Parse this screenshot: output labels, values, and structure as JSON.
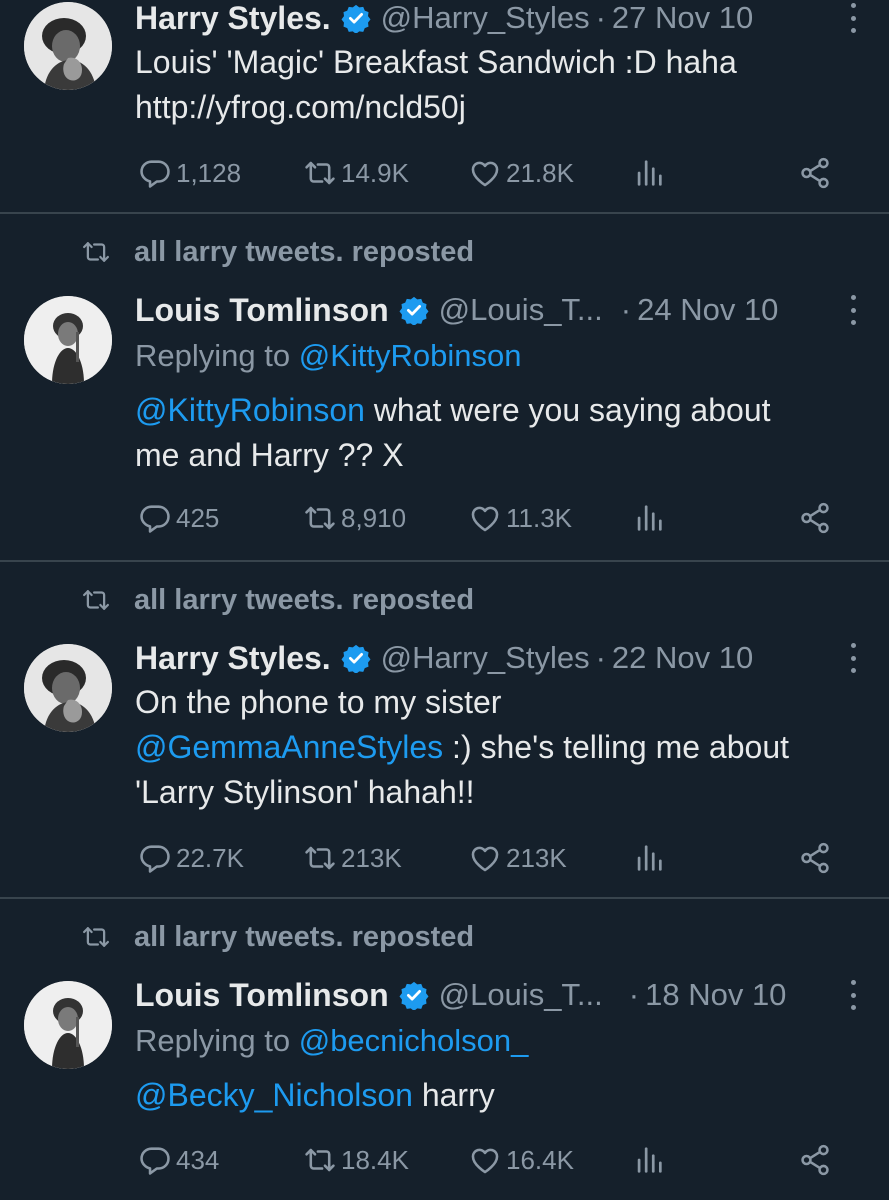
{
  "repost_label": "all larry tweets. reposted",
  "tweets": [
    {
      "name": "Harry Styles.",
      "handle": "@Harry_Styles",
      "date": "27 Nov 10",
      "replying_prefix": "",
      "replying_to": "",
      "mention": "",
      "text_line1": "Louis' 'Magic' Breakfast Sandwich :D haha",
      "text_line2": "http://yfrog.com/ncld50j",
      "text_line3": "",
      "replies": "1,128",
      "reposts": "14.9K",
      "likes": "21.8K"
    },
    {
      "name": "Louis Tomlinson",
      "handle": "@Louis_T...",
      "date": "24 Nov 10",
      "replying_prefix": "Replying to ",
      "replying_to": "@KittyRobinson",
      "mention": "@KittyRobinson",
      "text_line1": " what were you saying about",
      "text_line2": "me and Harry ?? X",
      "text_line3": "",
      "replies": "425",
      "reposts": "8,910",
      "likes": "11.3K"
    },
    {
      "name": "Harry Styles.",
      "handle": "@Harry_Styles",
      "date": "22 Nov 10",
      "replying_prefix": "",
      "replying_to": "",
      "mention": "@GemmaAnneStyles",
      "text_line1": "On the phone to my sister",
      "text_line2": " :) she's telling me about",
      "text_line3": "'Larry Stylinson' hahah!!",
      "replies": "22.7K",
      "reposts": "213K",
      "likes": "213K"
    },
    {
      "name": "Louis Tomlinson",
      "handle": "@Louis_T...",
      "date": "18 Nov 10",
      "replying_prefix": "Replying to ",
      "replying_to": "@becnicholson_",
      "mention": "@Becky_Nicholson",
      "text_line1": " harry",
      "text_line2": "",
      "text_line3": "",
      "replies": "434",
      "reposts": "18.4K",
      "likes": "16.4K"
    }
  ],
  "colors": {
    "background": "#15202b",
    "text": "#e7e9ea",
    "muted": "#8b98a5",
    "accent": "#1d9bf0",
    "divider": "#38444d"
  },
  "icons": [
    "repost-icon",
    "verified-badge-icon",
    "more-icon",
    "reply-icon",
    "like-icon",
    "views-icon",
    "share-icon"
  ]
}
